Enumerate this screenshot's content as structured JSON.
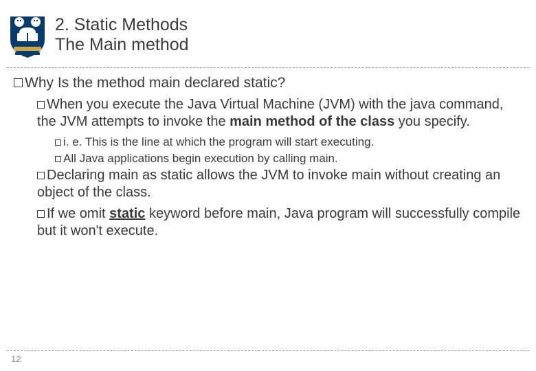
{
  "header": {
    "line1": "2. Static Methods",
    "line2": "The Main method"
  },
  "content": {
    "lvl1": {
      "text": "Why Is the method main declared static?"
    },
    "lvl2a": {
      "pre": "When you execute the Java Virtual Machine (JVM) with the java command, the JVM attempts to invoke the ",
      "bold": "main method of the class",
      "post": " you specify."
    },
    "lvl3a": {
      "text": "i. e. This is the line at which the program will start executing."
    },
    "lvl3b": {
      "text": "All Java applications begin execution by calling main."
    },
    "lvl2b": {
      "text": "Declaring main as static allows the JVM to invoke main without creating an object of the class."
    },
    "lvl2c": {
      "pre": "If we omit ",
      "underline": "static",
      "post": " keyword before main, Java program will successfully compile but it won't execute."
    }
  },
  "page_number": "12"
}
